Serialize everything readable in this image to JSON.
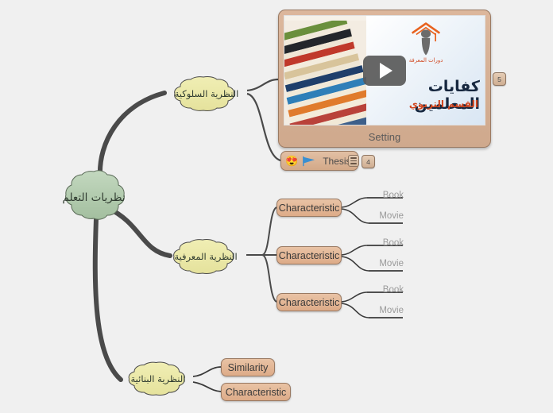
{
  "background_color": "#f0f0f0",
  "root": {
    "label": "نظريات التعلم",
    "shape": "cloud",
    "fill": "#aec9ab"
  },
  "branches": [
    {
      "label": "النظرية السلوكية",
      "shape": "cloud",
      "fill": "#ece9a8",
      "children": [
        {
          "label": "Setting",
          "type": "image-node",
          "badge": "5"
        },
        {
          "label": "Thesis",
          "type": "rect-node",
          "badge": "4",
          "icons": [
            "heart-eyes-emoji",
            "blue-flag-icon",
            "notes-icon"
          ]
        }
      ]
    },
    {
      "label": "النظرية المعرفية",
      "shape": "cloud",
      "fill": "#ece9a8",
      "children": [
        {
          "label": "Characteristic",
          "type": "rect-node",
          "children": [
            {
              "label": "Book"
            },
            {
              "label": "Movie"
            }
          ]
        },
        {
          "label": "Characteristic",
          "type": "rect-node",
          "children": [
            {
              "label": "Book"
            },
            {
              "label": "Movie"
            }
          ]
        },
        {
          "label": "Characteristic",
          "type": "rect-node",
          "children": [
            {
              "label": "Book"
            },
            {
              "label": "Movie"
            }
          ]
        }
      ]
    },
    {
      "label": "النظرية البنائية",
      "shape": "cloud",
      "fill": "#ece9a8",
      "children": [
        {
          "label": "Similarity",
          "type": "rect-node"
        },
        {
          "label": "Characteristic",
          "type": "rect-node"
        }
      ]
    }
  ],
  "video_card": {
    "caption": "Setting",
    "slide_title": "كفايات المعلمين",
    "slide_subtitle": "القسم التربوي",
    "logo_text": "دورات المعرفة",
    "play_label": "play-button",
    "badge": "5",
    "frame_color": "#d4b49a"
  },
  "thesis_card": {
    "label": "Thesis",
    "emoji": "😍",
    "flag": "blue-flag",
    "badge": "4"
  },
  "characteristics": [
    {
      "label": "Characteristic",
      "book": "Book",
      "movie": "Movie"
    },
    {
      "label": "Characteristic",
      "book": "Book",
      "movie": "Movie"
    },
    {
      "label": "Characteristic",
      "book": "Book",
      "movie": "Movie"
    }
  ],
  "constructivist_children": [
    {
      "label": "Similarity"
    },
    {
      "label": "Characteristic"
    }
  ],
  "colors": {
    "connector": "#4a4a4a",
    "cloud_green": "#aec9ab",
    "cloud_yellow": "#ece9a8",
    "rect_node": "#ddab88",
    "leaf_text": "#9a9a9a"
  }
}
